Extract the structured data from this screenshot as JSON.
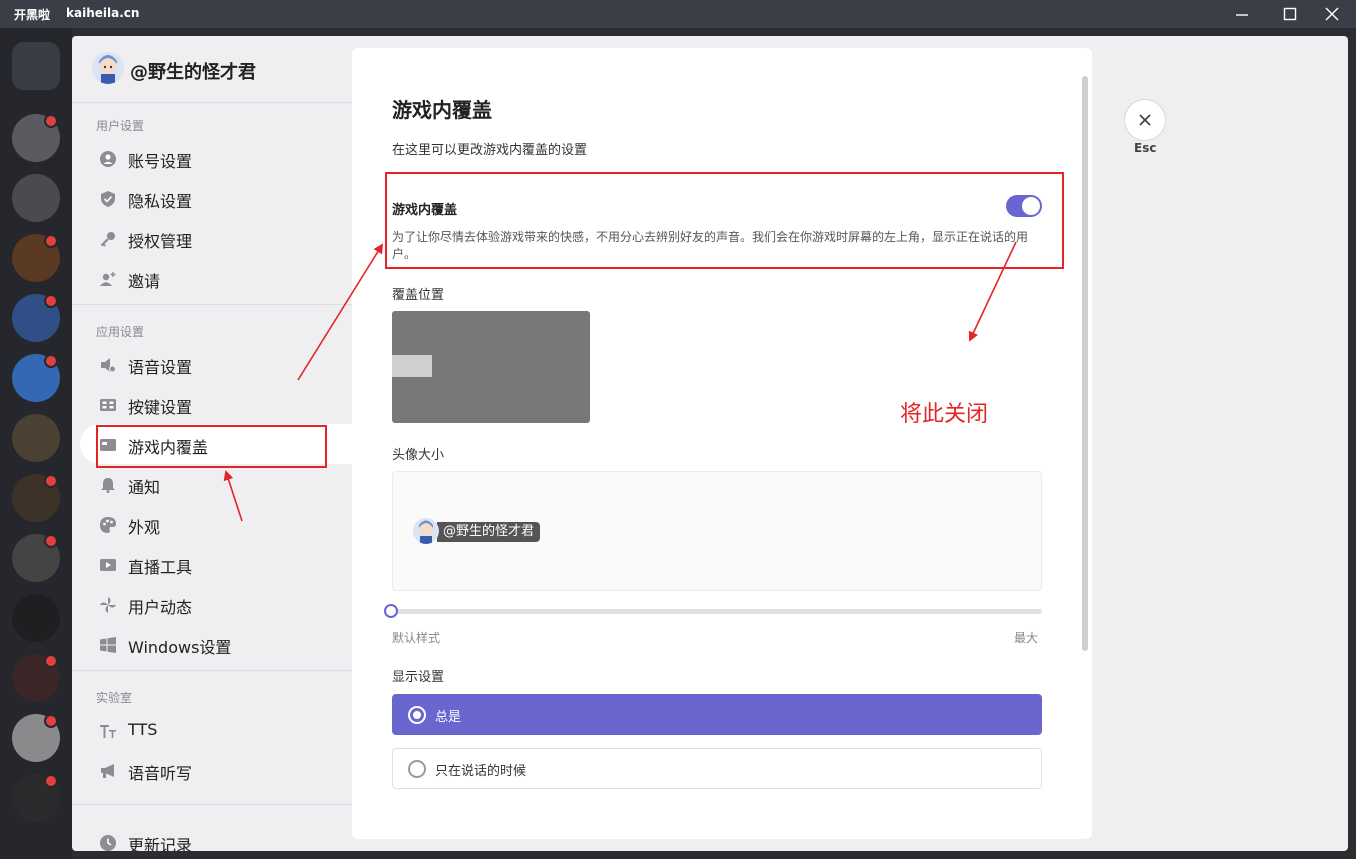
{
  "titlebar": {
    "brand": "开黑啦",
    "domain": "kaiheila.cn"
  },
  "user": {
    "name": "@野生的怪才君"
  },
  "sidebar": {
    "user_settings_title": "用户设置",
    "app_settings_title": "应用设置",
    "lab_title": "实验室",
    "items": [
      {
        "label": "账号设置",
        "icon": "account-icon"
      },
      {
        "label": "隐私设置",
        "icon": "shield-icon"
      },
      {
        "label": "授权管理",
        "icon": "key-icon"
      },
      {
        "label": "邀请",
        "icon": "invite-icon"
      },
      {
        "label": "语音设置",
        "icon": "speaker-gear-icon"
      },
      {
        "label": "按键设置",
        "icon": "keyboard-icon"
      },
      {
        "label": "游戏内覆盖",
        "icon": "overlay-icon",
        "active": true
      },
      {
        "label": "通知",
        "icon": "bell-icon"
      },
      {
        "label": "外观",
        "icon": "palette-icon"
      },
      {
        "label": "直播工具",
        "icon": "video-icon"
      },
      {
        "label": "用户动态",
        "icon": "pinwheel-icon"
      },
      {
        "label": "Windows设置",
        "icon": "windows-icon"
      },
      {
        "label": "TTS",
        "icon": "text-size-icon"
      },
      {
        "label": "语音听写",
        "icon": "megaphone-icon"
      },
      {
        "label": "更新记录",
        "icon": "clock-icon"
      }
    ]
  },
  "content": {
    "title": "游戏内覆盖",
    "subtitle": "在这里可以更改游戏内覆盖的设置",
    "overlay_toggle": {
      "label": "游戏内覆盖",
      "description": "为了让你尽情去体验游戏带来的快感，不用分心去辨别好友的声音。我们会在你游戏时屏幕的左上角，显示正在说话的用户。",
      "enabled": true
    },
    "position_label": "覆盖位置",
    "avatar_size_label": "头像大小",
    "preview_name": "@野生的怪才君",
    "avatar_size_slider": {
      "min_label": "默认样式",
      "max_label": "最大",
      "value": 0
    },
    "display_label": "显示设置",
    "display_options": [
      {
        "label": "总是",
        "selected": true
      },
      {
        "label": "只在说话的时候",
        "selected": false
      }
    ]
  },
  "close": {
    "label": "Esc"
  },
  "annotation": {
    "text": "将此关闭"
  },
  "colors": {
    "accent": "#6966cf",
    "annotation": "#e42525",
    "rail": "#26272c"
  }
}
